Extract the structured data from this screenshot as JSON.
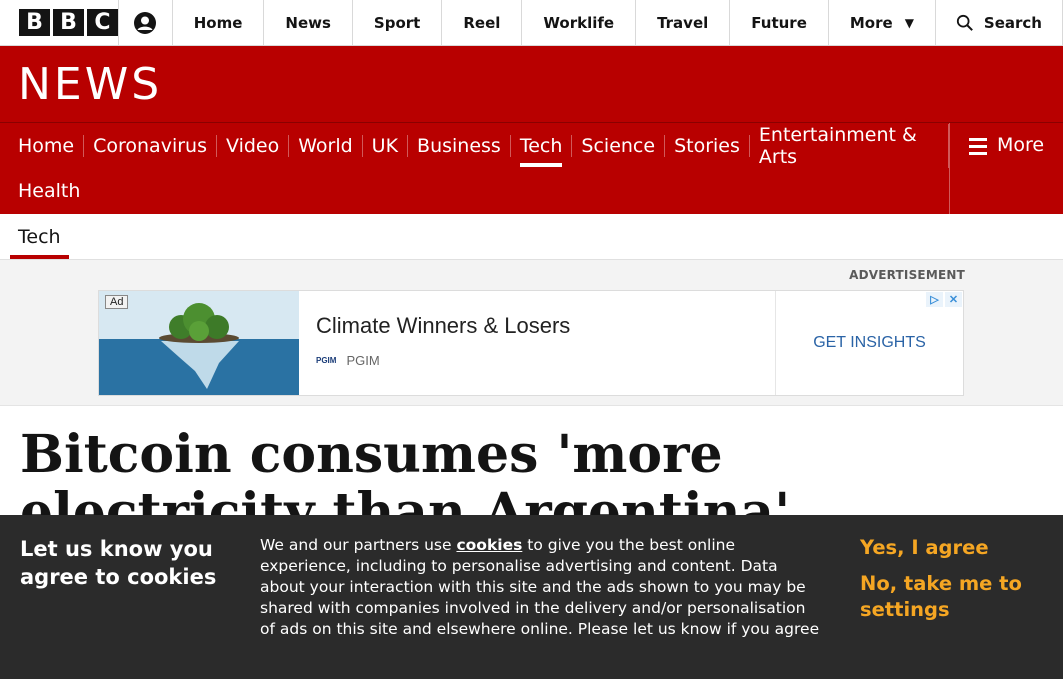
{
  "global_nav": {
    "logo_letters": [
      "B",
      "B",
      "C"
    ],
    "items": [
      {
        "label": "Home"
      },
      {
        "label": "News"
      },
      {
        "label": "Sport"
      },
      {
        "label": "Reel"
      },
      {
        "label": "Worklife"
      },
      {
        "label": "Travel"
      },
      {
        "label": "Future"
      }
    ],
    "more_label": "More",
    "search_label": "Search"
  },
  "banner": {
    "title": "NEWS"
  },
  "section_nav": {
    "row1": [
      {
        "label": "Home"
      },
      {
        "label": "Coronavirus"
      },
      {
        "label": "Video"
      },
      {
        "label": "World"
      },
      {
        "label": "UK"
      },
      {
        "label": "Business"
      },
      {
        "label": "Tech",
        "active": true
      },
      {
        "label": "Science"
      },
      {
        "label": "Stories"
      },
      {
        "label": "Entertainment & Arts"
      }
    ],
    "row2": [
      {
        "label": "Health"
      }
    ],
    "more_label": "More"
  },
  "sub_nav": {
    "items": [
      {
        "label": "Tech"
      }
    ]
  },
  "advertisement": {
    "label": "ADVERTISEMENT",
    "badge": "Ad",
    "headline": "Climate Winners & Losers",
    "brand": "PGIM",
    "brand_logo_text": "PGIM",
    "cta": "GET INSIGHTS",
    "controls": [
      "▷",
      "✕"
    ]
  },
  "article": {
    "headline": "Bitcoin consumes 'more electricity than Argentina'"
  },
  "cookie_banner": {
    "title": "Let us know you agree to cookies",
    "body_prefix": "We and our partners use ",
    "body_link": "cookies",
    "body_suffix": " to give you the best online experience, including to personalise advertising and content. Data about your interaction with this site and the ads shown to you may be shared with companies involved in the delivery and/or personalisation of ads on this site and elsewhere online. Please let us know if you agree",
    "accept_label": "Yes, I agree",
    "settings_label": "No, take me to settings"
  },
  "colors": {
    "brand_red": "#b80000",
    "cookie_bg": "#2b2b2b",
    "cookie_accent": "#f5a623"
  }
}
